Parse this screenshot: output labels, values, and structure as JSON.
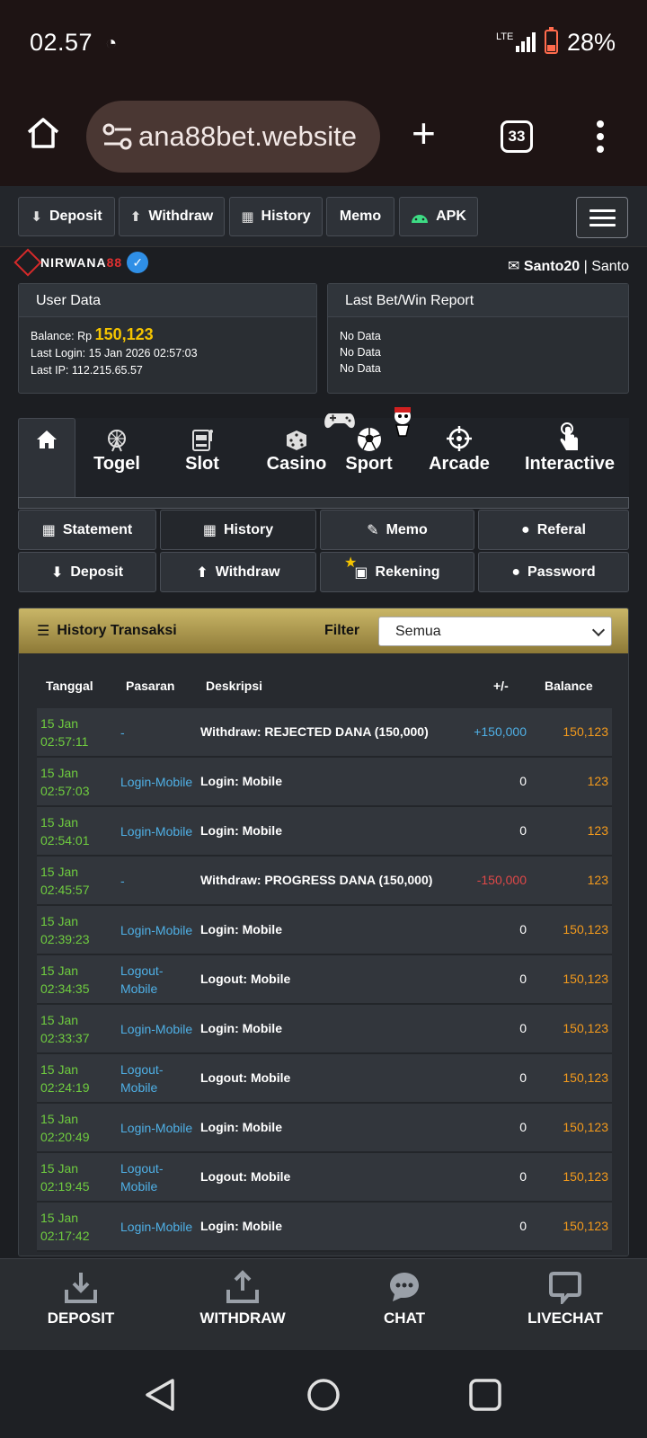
{
  "status": {
    "time": "02.57",
    "signal": "LTE",
    "battery": "28%"
  },
  "browser": {
    "url": "ana88bet.website",
    "tab_count": "33"
  },
  "topnav": {
    "deposit": "Deposit",
    "withdraw": "Withdraw",
    "history": "History",
    "memo": "Memo",
    "apk": "APK"
  },
  "brand": {
    "name_a": "NIRWANA",
    "name_b": "88"
  },
  "user": {
    "username": "Santo20",
    "name": "Santo"
  },
  "user_data": {
    "title": "User Data",
    "balance_label": "Balance: Rp",
    "balance": "150,123",
    "last_login": "Last Login: 15 Jan 2026 02:57:03",
    "last_ip": "Last IP: 112.215.65.57"
  },
  "report": {
    "title": "Last Bet/Win Report",
    "lines": [
      "No Data",
      "No Data",
      "No Data"
    ]
  },
  "categories": [
    "Togel",
    "Slot",
    "Casino",
    "Sport",
    "Arcade",
    "Interactive"
  ],
  "submenu": {
    "statement": "Statement",
    "history": "History",
    "memo": "Memo",
    "referal": "Referal",
    "deposit": "Deposit",
    "withdraw": "Withdraw",
    "rekening": "Rekening",
    "password": "Password"
  },
  "history": {
    "title": "History Transaksi",
    "filter_label": "Filter",
    "filter_value": "Semua",
    "headers": {
      "date": "Tanggal",
      "market": "Pasaran",
      "desc": "Deskripsi",
      "amount": "+/-",
      "balance": "Balance"
    },
    "rows": [
      {
        "d1": "15 Jan",
        "d2": "02:57:11",
        "m1": "-",
        "m2": "",
        "desc": "Withdraw: REJECTED DANA (150,000)",
        "amt": "+150,000",
        "bal": "150,123"
      },
      {
        "d1": "15 Jan",
        "d2": "02:57:03",
        "m1": "Login-Mobile",
        "m2": "",
        "desc": "Login: Mobile",
        "amt": "0",
        "bal": "123"
      },
      {
        "d1": "15 Jan",
        "d2": "02:54:01",
        "m1": "Login-Mobile",
        "m2": "",
        "desc": "Login: Mobile",
        "amt": "0",
        "bal": "123"
      },
      {
        "d1": "15 Jan",
        "d2": "02:45:57",
        "m1": "-",
        "m2": "",
        "desc": "Withdraw: PROGRESS DANA (150,000)",
        "amt": "-150,000",
        "bal": "123"
      },
      {
        "d1": "15 Jan",
        "d2": "02:39:23",
        "m1": "Login-Mobile",
        "m2": "",
        "desc": "Login: Mobile",
        "amt": "0",
        "bal": "150,123"
      },
      {
        "d1": "15 Jan",
        "d2": "02:34:35",
        "m1": "Logout-",
        "m2": "Mobile",
        "desc": "Logout: Mobile",
        "amt": "0",
        "bal": "150,123"
      },
      {
        "d1": "15 Jan",
        "d2": "02:33:37",
        "m1": "Login-Mobile",
        "m2": "",
        "desc": "Login: Mobile",
        "amt": "0",
        "bal": "150,123"
      },
      {
        "d1": "15 Jan",
        "d2": "02:24:19",
        "m1": "Logout-",
        "m2": "Mobile",
        "desc": "Logout: Mobile",
        "amt": "0",
        "bal": "150,123"
      },
      {
        "d1": "15 Jan",
        "d2": "02:20:49",
        "m1": "Login-Mobile",
        "m2": "",
        "desc": "Login: Mobile",
        "amt": "0",
        "bal": "150,123"
      },
      {
        "d1": "15 Jan",
        "d2": "02:19:45",
        "m1": "Logout-",
        "m2": "Mobile",
        "desc": "Logout: Mobile",
        "amt": "0",
        "bal": "150,123"
      },
      {
        "d1": "15 Jan",
        "d2": "02:17:42",
        "m1": "Login-Mobile",
        "m2": "",
        "desc": "Login: Mobile",
        "amt": "0",
        "bal": "150,123"
      }
    ]
  },
  "bottomnav": {
    "deposit": "DEPOSIT",
    "withdraw": "WITHDRAW",
    "chat": "CHAT",
    "livechat": "LIVECHAT"
  }
}
